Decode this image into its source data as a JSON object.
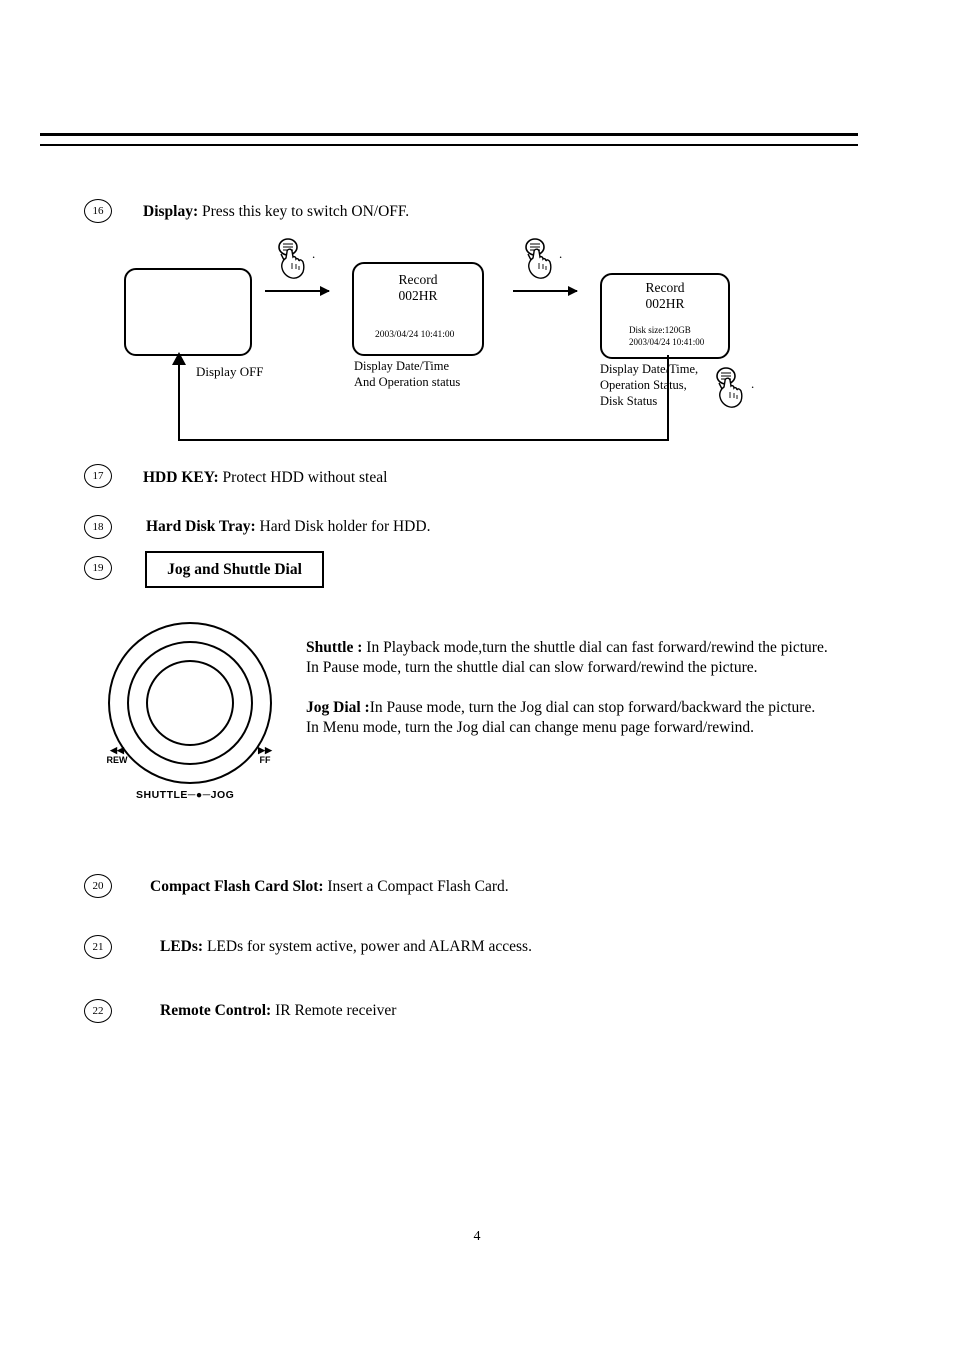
{
  "page": {
    "number": "4"
  },
  "items": [
    {
      "num": "16",
      "label": "Display:",
      "desc": " Press this key to switch ON/OFF."
    },
    {
      "num": "17",
      "label": "HDD KEY:",
      "desc": " Protect HDD without steal"
    },
    {
      "num": "18",
      "label": "Hard Disk Tray:",
      "desc": " Hard Disk holder for HDD."
    },
    {
      "num": "19",
      "label": "Jog and Shuttle Dial",
      "desc": ""
    },
    {
      "num": "20",
      "label": "Compact Flash Card Slot:",
      "desc": " Insert a Compact Flash Card."
    },
    {
      "num": "21",
      "label": "LEDs:",
      "desc": " LEDs for system active, power and ALARM access."
    },
    {
      "num": "22",
      "label": "Remote Control:",
      "desc": " IR Remote receiver"
    }
  ],
  "display_diagram": {
    "screen1": {
      "caption": "Display OFF"
    },
    "screen2": {
      "line1": "Record",
      "line2": "002HR",
      "status": "2003/04/24 10:41:00",
      "caption_line1": "Display Date/Time",
      "caption_line2": "And Operation status"
    },
    "screen3": {
      "line1": "Record",
      "line2": "002HR",
      "disk": "Disk size:120GB",
      "status": "2003/04/24 10:41:00",
      "caption_line1": "Display Date/Time,",
      "caption_line2": "Operation Status,",
      "caption_line3": "Disk Status"
    },
    "hand_dot": "."
  },
  "jog_shuttle": {
    "box_label": "Jog and Shuttle Dial",
    "dial_rew_symbol": "◀◀",
    "dial_rew_label": "REW",
    "dial_ff_symbol": "▶▶",
    "dial_ff_label": "FF",
    "dial_bottom_label": "SHUTTLE─●─JOG",
    "shuttle_title": "Shuttle :",
    "shuttle_line1": " In Playback mode,turn the shuttle dial can fast forward/rewind the picture.",
    "shuttle_line2": "In Pause mode, turn the shuttle dial can slow forward/rewind the picture.",
    "jog_title": "Jog Dial :",
    "jog_line1": "In Pause mode, turn the Jog dial can stop forward/backward the picture.",
    "jog_line2": "In Menu mode, turn the Jog dial can change menu page forward/rewind."
  }
}
